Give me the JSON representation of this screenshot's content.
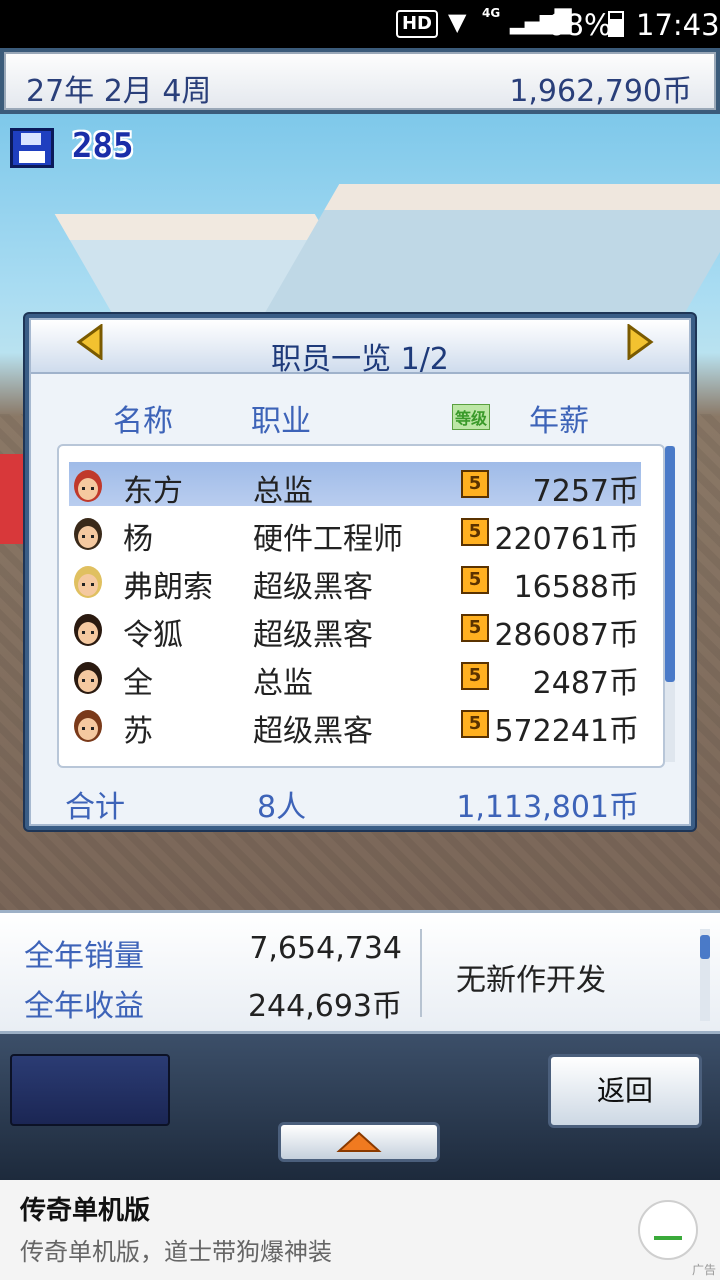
{
  "status_bar": {
    "hd": "HD",
    "network": "4G",
    "battery": "68%",
    "time": "17:43"
  },
  "top_bar": {
    "date": "27年 2月 4周",
    "money": "1,962,790币"
  },
  "save": {
    "count": "285"
  },
  "staff_dialog": {
    "title": "职员一览 1/2",
    "headers": {
      "name": "名称",
      "job": "职业",
      "level": "等级",
      "salary": "年薪"
    },
    "rows": [
      {
        "name": "东方",
        "job": "总监",
        "level": "5",
        "salary": "7257币",
        "selected": true
      },
      {
        "name": "杨",
        "job": "硬件工程师",
        "level": "5",
        "salary": "220761币",
        "selected": false
      },
      {
        "name": "弗朗索",
        "job": "超级黑客",
        "level": "5",
        "salary": "16588币",
        "selected": false
      },
      {
        "name": "令狐",
        "job": "超级黑客",
        "level": "5",
        "salary": "286087币",
        "selected": false
      },
      {
        "name": "全",
        "job": "总监",
        "level": "5",
        "salary": "2487币",
        "selected": false
      },
      {
        "name": "苏",
        "job": "超级黑客",
        "level": "5",
        "salary": "572241币",
        "selected": false
      }
    ],
    "footer": {
      "label": "合计",
      "count": "8人",
      "total": "1,113,801币"
    }
  },
  "stats": {
    "sales_label": "全年销量",
    "sales_value": "7,654,734",
    "revenue_label": "全年收益",
    "revenue_value": "244,693币",
    "message": "无新作开发"
  },
  "controls": {
    "back_label": "返回"
  },
  "ad": {
    "title": "传奇单机版",
    "subtitle": "传奇单机版，道士带狗爆神装",
    "tag": "广告"
  },
  "colors": {
    "accent_blue": "#3d63b8",
    "title_blue": "#1e3a7a",
    "selection": "#9fbbe8",
    "level_badge": "#ffb020"
  }
}
